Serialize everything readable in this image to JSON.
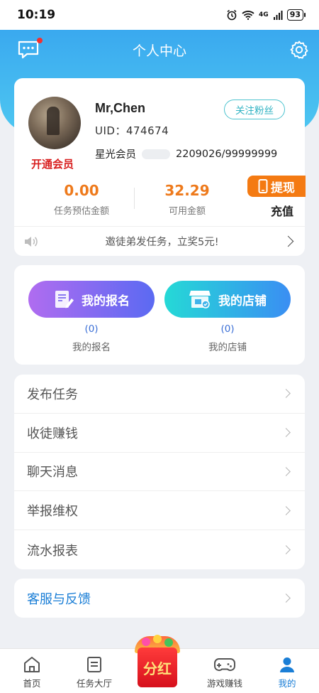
{
  "status_bar": {
    "time": "10:19",
    "network": "4G",
    "battery": "93"
  },
  "header": {
    "title": "个人中心"
  },
  "profile": {
    "vip_open": "开通会员",
    "username": "Mr,Chen",
    "uid": "UID：474674",
    "follow_label": "关注粉丝",
    "member_label": "星光会员",
    "member_value": "2209026/99999999",
    "estimated": {
      "value": "0.00",
      "label": "任务预估金额"
    },
    "available": {
      "value": "32.29",
      "label": "可用金额"
    },
    "withdraw_label": "提现",
    "recharge_label": "充值",
    "notice": "邀徒弟发任务，立奖5元!"
  },
  "quick_actions": {
    "signup": {
      "label": "我的报名",
      "count": "(0)",
      "caption": "我的报名"
    },
    "shop": {
      "label": "我的店铺",
      "count": "(0)",
      "caption": "我的店铺"
    }
  },
  "menu": [
    {
      "label": "发布任务"
    },
    {
      "label": "收徒赚钱"
    },
    {
      "label": "聊天消息"
    },
    {
      "label": "举报维权"
    },
    {
      "label": "流水报表"
    }
  ],
  "service": {
    "label": "客服与反馈"
  },
  "bottom_nav": {
    "home": "首页",
    "tasks": "任务大厅",
    "bonus": "分红",
    "games": "游戏赚钱",
    "mine": "我的"
  },
  "colors": {
    "accent": "#3aa9ef",
    "orange": "#ee7a1c",
    "active": "#1a7ed6"
  }
}
